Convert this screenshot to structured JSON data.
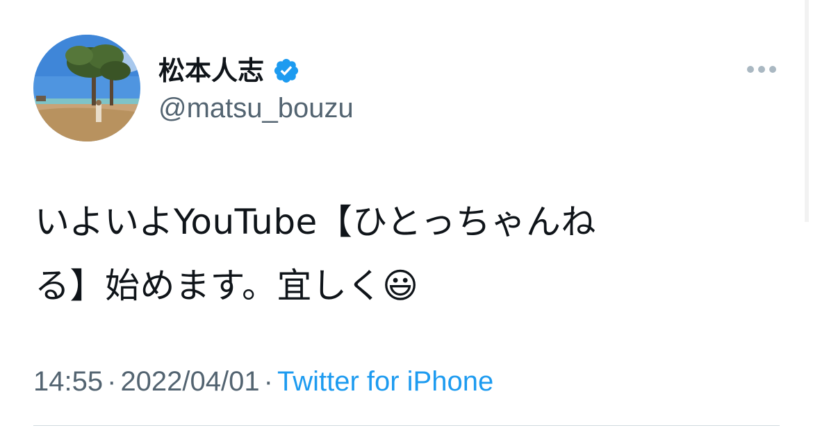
{
  "user": {
    "display_name": "松本人志",
    "handle": "@matsu_bouzu",
    "verified_icon": "verified-badge-icon"
  },
  "tweet": {
    "line1": "いよいよYouTube【ひとっちゃんね",
    "line2": "る】始めます。宜しく😃",
    "time": "14:55",
    "date": "2022/04/01",
    "separator": "·",
    "source": "Twitter for iPhone"
  },
  "more_menu": {
    "icon": "more-options-icon"
  },
  "colors": {
    "accent": "#1d9bf0",
    "secondary_text": "#536471",
    "verified": "#1d9bf0"
  }
}
